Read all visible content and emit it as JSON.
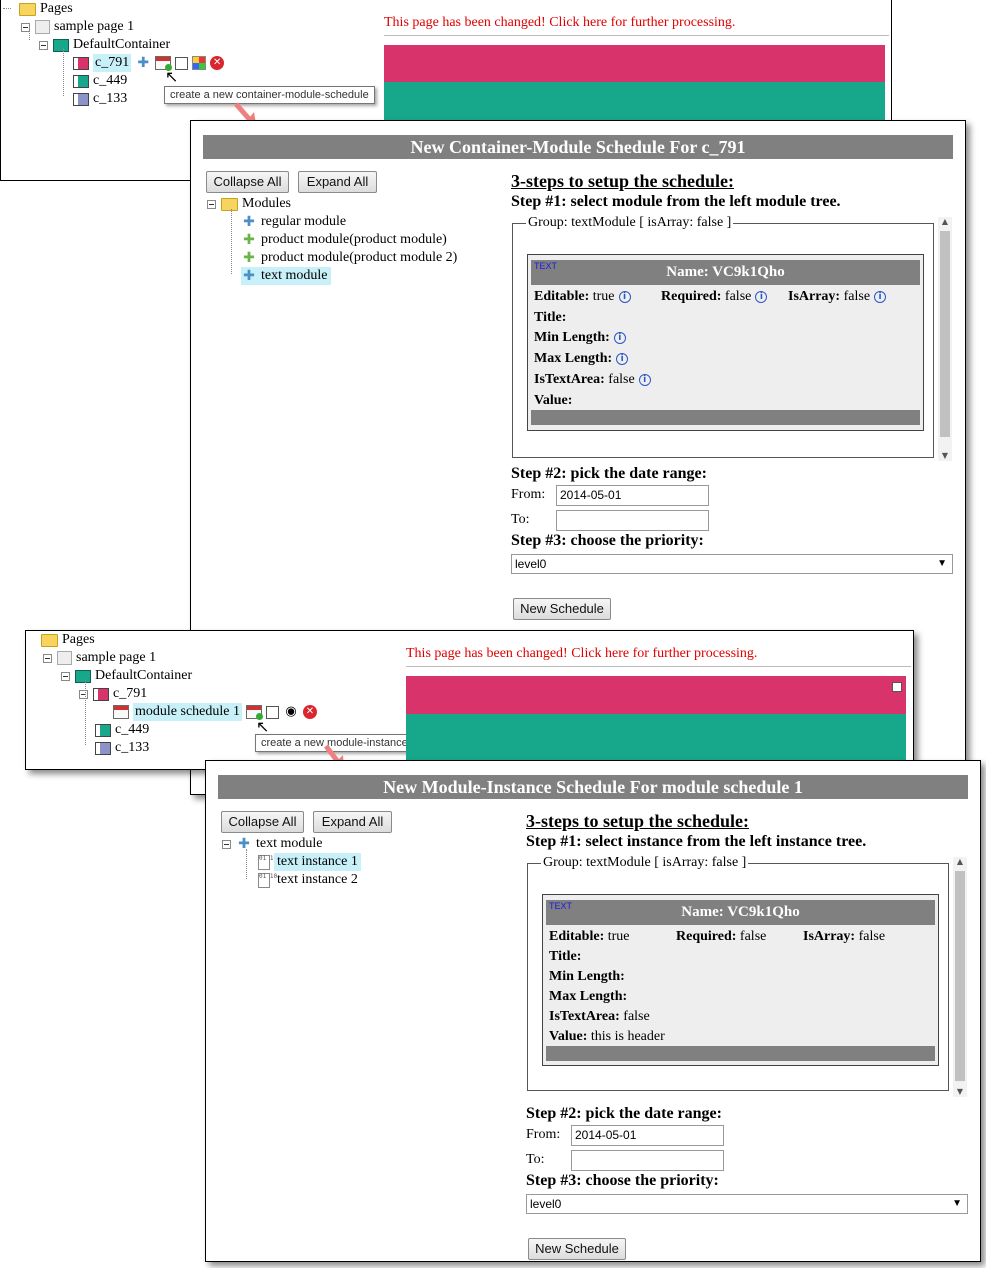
{
  "top": {
    "tree": {
      "pages": "Pages",
      "sample_page": "sample page 1",
      "default_container": "DefaultContainer",
      "c791": "c_791",
      "c449": "c_449",
      "c133": "c_133"
    },
    "changed_notice": "This page has been changed! Click here for further processing.",
    "tooltip": "create a new container-module-schedule",
    "colors": {
      "magenta": "#d8336b",
      "teal": "#17a88c"
    }
  },
  "dialog1": {
    "title": "New Container-Module Schedule For c_791",
    "collapse_all": "Collapse All",
    "expand_all": "Expand All",
    "tree": {
      "root": "Modules",
      "items": [
        "regular module",
        "product module(product module)",
        "product module(product module 2)",
        "text module"
      ]
    },
    "steps_heading": "3-steps to setup the schedule:",
    "step1": "Step #1: select module from the left module tree.",
    "group_legend": "Group: textModule [ isArray: false ]",
    "badge": "TEXT",
    "name": "Name: VC9k1Qho",
    "props": {
      "editable_label": "Editable:",
      "editable_value": "true",
      "required_label": "Required:",
      "required_value": "false",
      "isarray_label": "IsArray:",
      "isarray_value": "false",
      "title_label": "Title:",
      "minlength_label": "Min Length:",
      "maxlength_label": "Max Length:",
      "istextarea_label": "IsTextArea:",
      "istextarea_value": "false",
      "value_label": "Value:",
      "value_value": ""
    },
    "step2": "Step #2: pick the date range:",
    "from_label": "From:",
    "from_value": "2014-05-01",
    "to_label": "To:",
    "to_value": "",
    "step3": "Step #3: choose the priority:",
    "priority": "level0",
    "new_schedule": "New Schedule"
  },
  "middle": {
    "tree": {
      "pages": "Pages",
      "sample_page": "sample page 1",
      "default_container": "DefaultContainer",
      "c791": "c_791",
      "module_schedule": "module schedule 1",
      "c449": "c_449",
      "c133": "c_133"
    },
    "changed_notice": "This page has been changed! Click here for further processing.",
    "tooltip": "create a new module-instance-schedule"
  },
  "dialog2": {
    "title": "New Module-Instance Schedule For module schedule 1",
    "collapse_all": "Collapse All",
    "expand_all": "Expand All",
    "tree": {
      "root": "text module",
      "items": [
        "text instance 1",
        "text instance 2"
      ]
    },
    "steps_heading": "3-steps to setup the schedule:",
    "step1": "Step #1: select instance from the left instance tree.",
    "group_legend": "Group: textModule [ isArray: false ]",
    "badge": "TEXT",
    "name": "Name: VC9k1Qho",
    "props": {
      "editable_label": "Editable:",
      "editable_value": "true",
      "required_label": "Required:",
      "required_value": "false",
      "isarray_label": "IsArray:",
      "isarray_value": "false",
      "title_label": "Title:",
      "minlength_label": "Min Length:",
      "maxlength_label": "Max Length:",
      "istextarea_label": "IsTextArea:",
      "istextarea_value": "false",
      "value_label": "Value:",
      "value_value": "this is header"
    },
    "step2": "Step #2: pick the date range:",
    "from_label": "From:",
    "from_value": "2014-05-01",
    "to_label": "To:",
    "to_value": "",
    "step3": "Step #3: choose the priority:",
    "priority": "level0",
    "new_schedule": "New Schedule"
  }
}
